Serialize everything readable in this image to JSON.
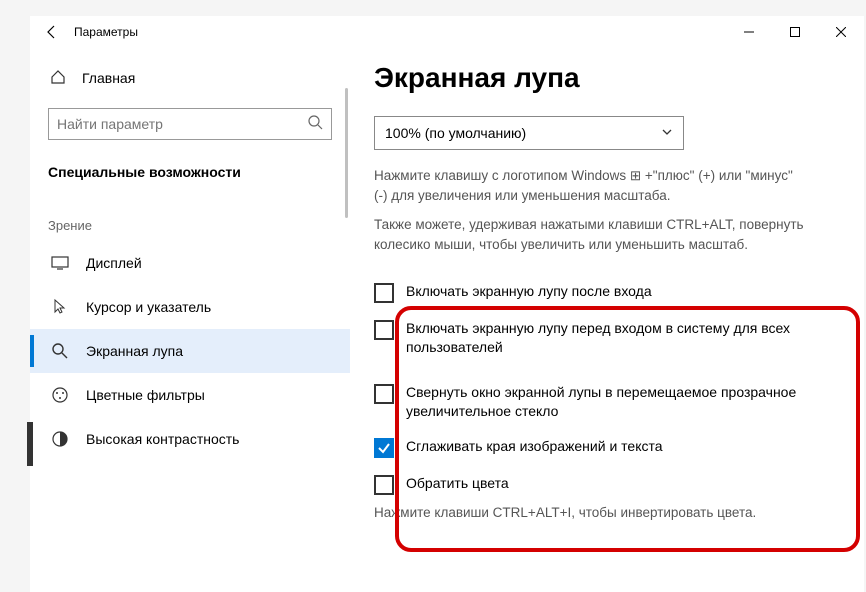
{
  "titlebar": {
    "title": "Параметры"
  },
  "sidebar": {
    "home": "Главная",
    "search_placeholder": "Найти параметр",
    "section": "Специальные возможности",
    "group_head": "Зрение",
    "items": [
      {
        "label": "Дисплей"
      },
      {
        "label": "Курсор и указатель"
      },
      {
        "label": "Экранная лупа"
      },
      {
        "label": "Цветные фильтры"
      },
      {
        "label": "Высокая контрастность"
      }
    ]
  },
  "main": {
    "heading": "Экранная лупа",
    "combo_value": "100% (по умолчанию)",
    "hint1": "Нажмите клавишу с логотипом Windows ⊞ +\"плюс\" (+) или \"минус\" (-) для увеличения или уменьшения масштаба.",
    "hint2": "Также можете, удерживая нажатыми клавиши CTRL+ALT, повернуть колесико мыши, чтобы увеличить или уменьшить масштаб.",
    "checks": [
      {
        "label": "Включать экранную лупу после входа",
        "checked": false
      },
      {
        "label": "Включать экранную лупу перед входом в систему для всех пользователей",
        "checked": false
      },
      {
        "label": "Свернуть окно экранной лупы в перемещаемое прозрачное увеличительное стекло",
        "checked": false
      },
      {
        "label": "Сглаживать края изображений и текста",
        "checked": true
      },
      {
        "label": "Обратить цвета",
        "checked": false
      }
    ],
    "hint3": "Нажмите клавиши CTRL+ALT+I, чтобы инвертировать цвета."
  }
}
